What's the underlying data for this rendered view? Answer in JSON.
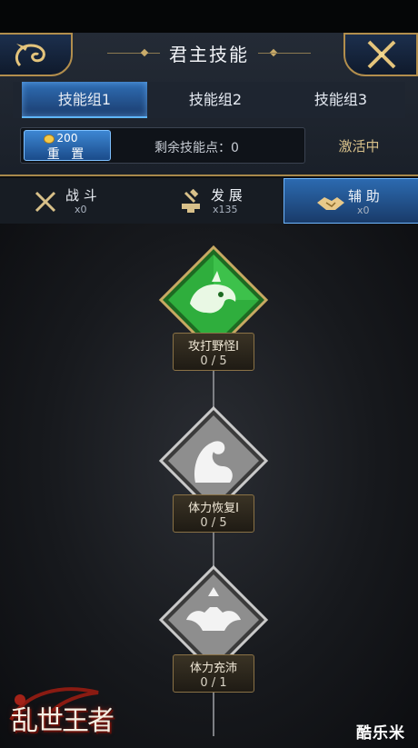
{
  "header": {
    "title": "君主技能",
    "back_icon": "dragon-emblem-icon",
    "close_icon": "crossed-swords-close-icon"
  },
  "skill_groups": {
    "tabs": [
      {
        "label": "技能组1",
        "active": true
      },
      {
        "label": "技能组2",
        "active": false
      },
      {
        "label": "技能组3",
        "active": false
      }
    ]
  },
  "points": {
    "reset_cost": "200",
    "reset_label": "重 置",
    "remaining_label": "剩余技能点：0",
    "status": "激活中"
  },
  "categories": [
    {
      "label": "战 斗",
      "count": "x0",
      "icon": "crossed-swords-icon",
      "active": false
    },
    {
      "label": "发 展",
      "count": "x135",
      "icon": "anvil-hammer-icon",
      "active": false
    },
    {
      "label": "辅 助",
      "count": "x0",
      "icon": "handshake-icon",
      "active": true
    }
  ],
  "skills": [
    {
      "name": "攻打野怪I",
      "level": "0 / 5",
      "icon": "beast-head-icon",
      "state": "available",
      "color": "#2fae3d"
    },
    {
      "name": "体力恢复I",
      "level": "0 / 5",
      "icon": "flexed-arm-icon",
      "state": "locked",
      "color": "#9a9a9a"
    },
    {
      "name": "体力充沛",
      "level": "0 / 1",
      "icon": "strong-torso-icon",
      "state": "locked",
      "color": "#9a9a9a"
    }
  ],
  "branding": {
    "game_logo": "乱世王者",
    "watermark": "酷乐米"
  }
}
